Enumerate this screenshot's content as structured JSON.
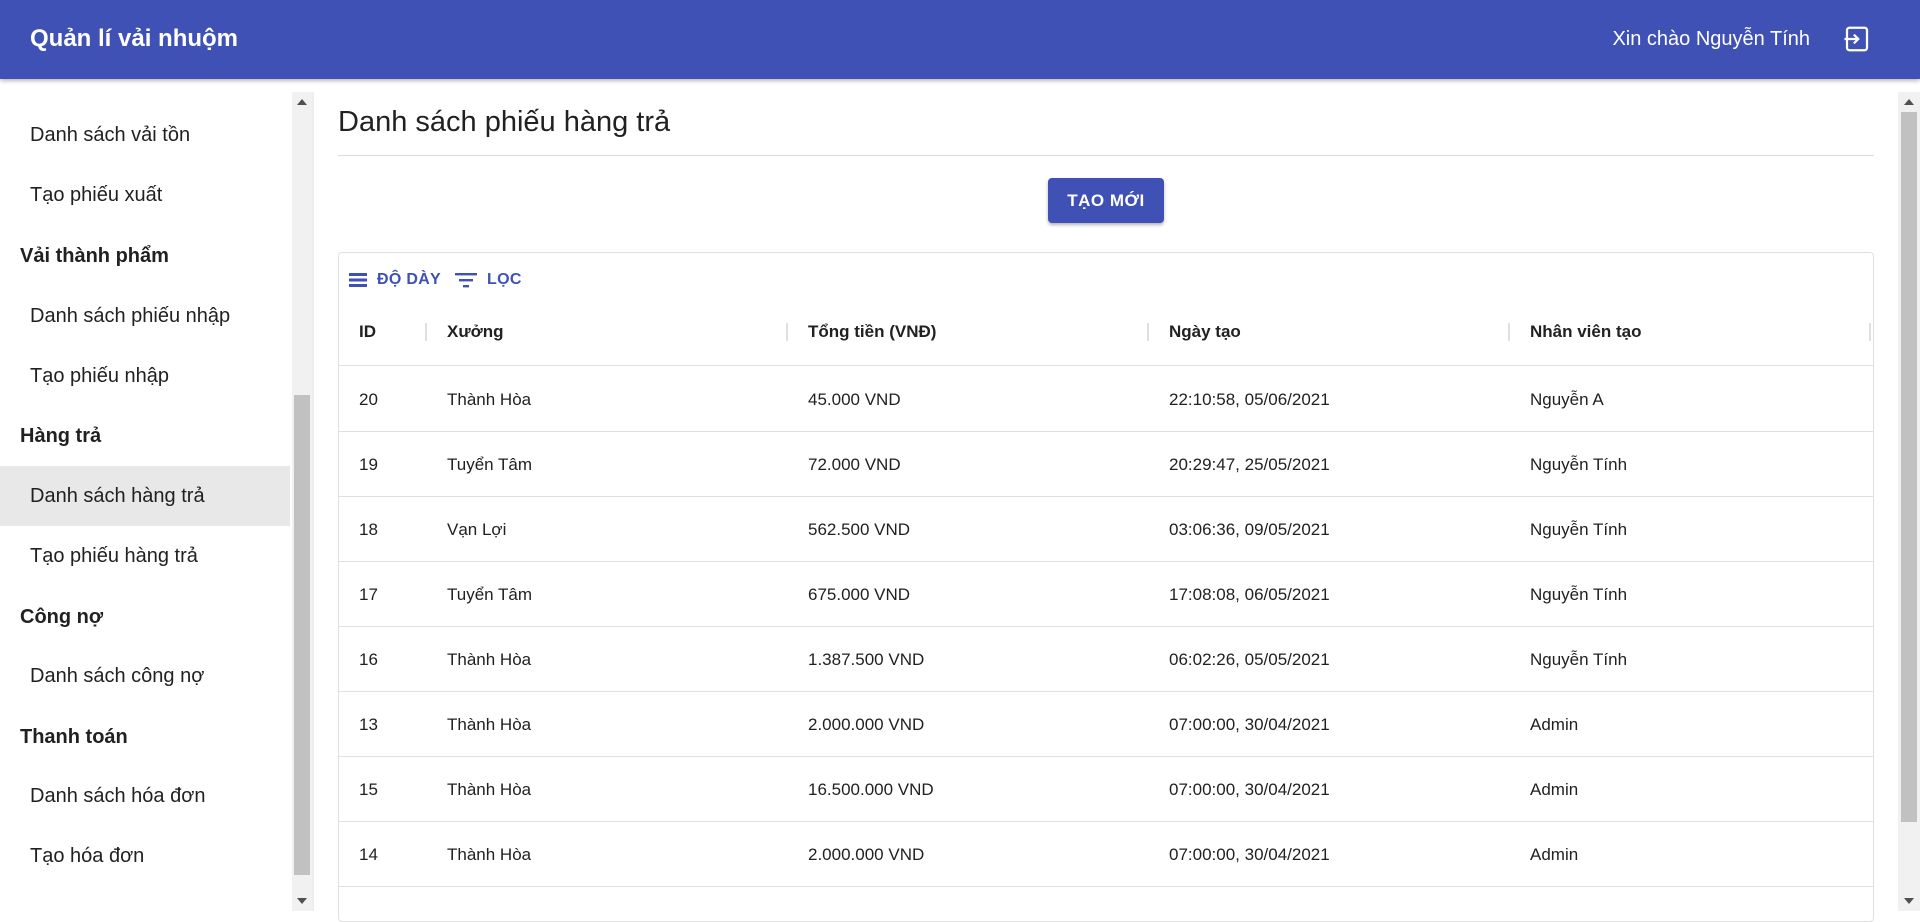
{
  "app": {
    "title": "Quản lí vải nhuộm",
    "greeting": "Xin chào Nguyễn Tính",
    "logout_icon": "logout-icon"
  },
  "sidebar": {
    "items": [
      {
        "type": "item",
        "label": "Danh sách vải tồn"
      },
      {
        "type": "item",
        "label": "Tạo phiếu xuất"
      },
      {
        "type": "section",
        "label": "Vải thành phẩm"
      },
      {
        "type": "item",
        "label": "Danh sách phiếu nhập"
      },
      {
        "type": "item",
        "label": "Tạo phiếu nhập"
      },
      {
        "type": "section",
        "label": "Hàng trả"
      },
      {
        "type": "item",
        "label": "Danh sách hàng trả",
        "active": true
      },
      {
        "type": "item",
        "label": "Tạo phiếu hàng trả"
      },
      {
        "type": "section",
        "label": "Công nợ"
      },
      {
        "type": "item",
        "label": "Danh sách công nợ"
      },
      {
        "type": "section",
        "label": "Thanh toán"
      },
      {
        "type": "item",
        "label": "Danh sách hóa đơn"
      },
      {
        "type": "item",
        "label": "Tạo hóa đơn"
      }
    ]
  },
  "main": {
    "title": "Danh sách phiếu hàng trả",
    "create_label": "TẠO MỚI",
    "toolbar": {
      "density_label": "ĐỘ DÀY",
      "filter_label": "LỌC"
    },
    "columns": [
      "ID",
      "Xưởng",
      "Tổng tiền (VNĐ)",
      "Ngày tạo",
      "Nhân viên tạo"
    ],
    "rows": [
      {
        "id": "20",
        "xuong": "Thành Hòa",
        "tong": "45.000 VND",
        "ngay": "22:10:58, 05/06/2021",
        "nv": "Nguyễn A"
      },
      {
        "id": "19",
        "xuong": "Tuyển Tâm",
        "tong": "72.000 VND",
        "ngay": "20:29:47, 25/05/2021",
        "nv": "Nguyễn Tính"
      },
      {
        "id": "18",
        "xuong": "Vạn Lợi",
        "tong": "562.500 VND",
        "ngay": "03:06:36, 09/05/2021",
        "nv": "Nguyễn Tính"
      },
      {
        "id": "17",
        "xuong": "Tuyển Tâm",
        "tong": "675.000 VND",
        "ngay": "17:08:08, 06/05/2021",
        "nv": "Nguyễn Tính"
      },
      {
        "id": "16",
        "xuong": "Thành Hòa",
        "tong": "1.387.500 VND",
        "ngay": "06:02:26, 05/05/2021",
        "nv": "Nguyễn Tính"
      },
      {
        "id": "13",
        "xuong": "Thành Hòa",
        "tong": "2.000.000 VND",
        "ngay": "07:00:00, 30/04/2021",
        "nv": "Admin"
      },
      {
        "id": "15",
        "xuong": "Thành Hòa",
        "tong": "16.500.000 VND",
        "ngay": "07:00:00, 30/04/2021",
        "nv": "Admin"
      },
      {
        "id": "14",
        "xuong": "Thành Hòa",
        "tong": "2.000.000 VND",
        "ngay": "07:00:00, 30/04/2021",
        "nv": "Admin"
      }
    ]
  },
  "colors": {
    "primary": "#3f51b5",
    "active_nav_bg": "#e8e8e8"
  }
}
